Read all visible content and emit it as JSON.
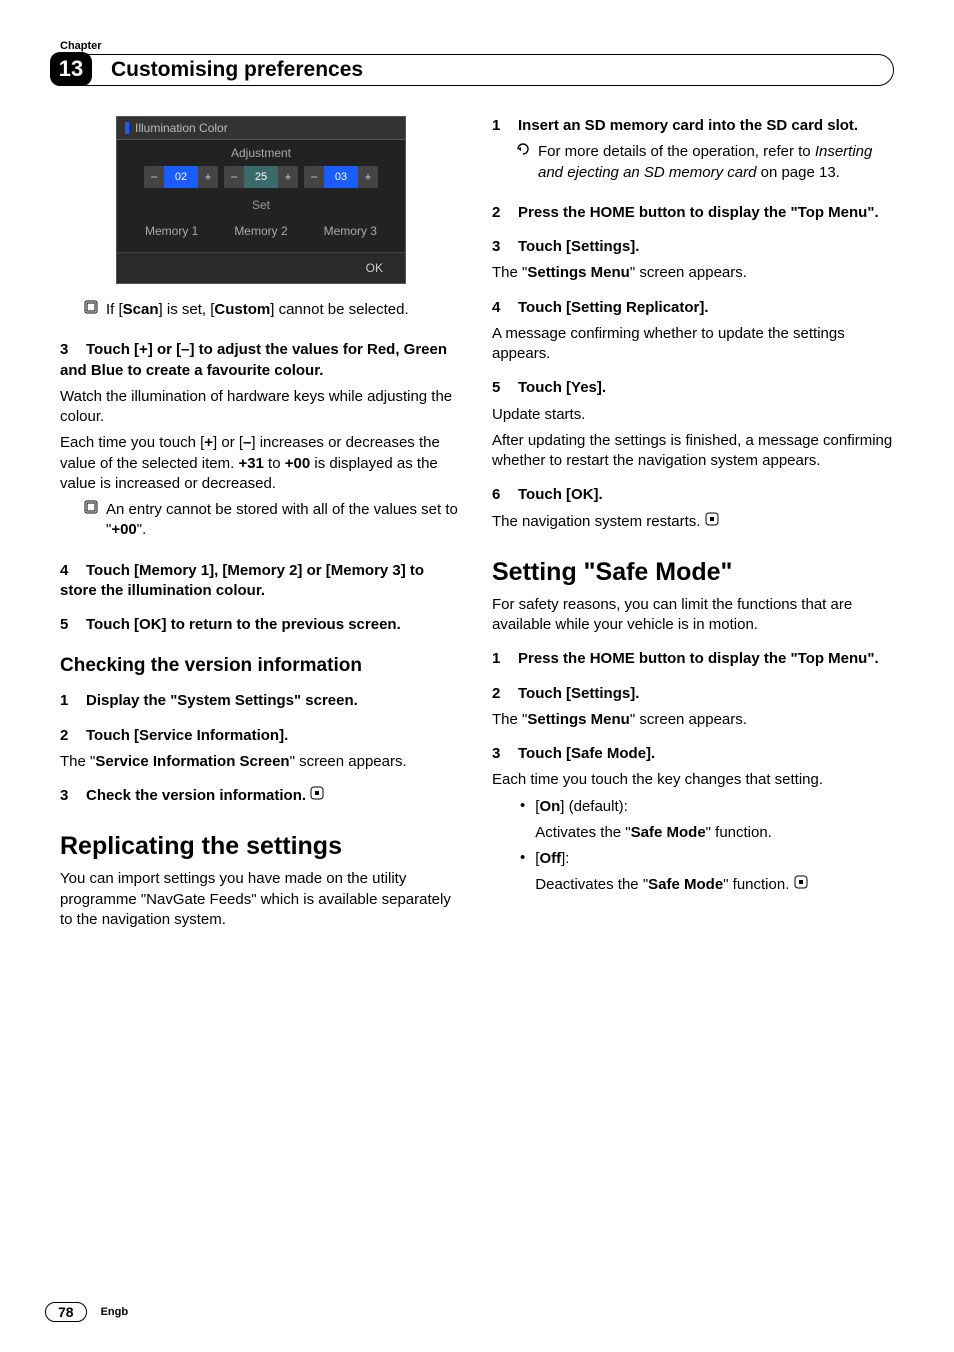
{
  "header": {
    "chapter_label": "Chapter",
    "chapter_number": "13",
    "title": "Customising preferences"
  },
  "screenshot": {
    "title": "Illumination Color",
    "adjustment": "Adjustment",
    "minus": "−",
    "plus": "+",
    "r_val": "02",
    "g_val": "25",
    "b_val": "03",
    "set": "Set",
    "mem1": "Memory 1",
    "mem2": "Memory 2",
    "mem3": "Memory 3",
    "ok": "OK"
  },
  "left": {
    "note_scan_a": "If [",
    "note_scan_b": "Scan",
    "note_scan_c": "] is set, [",
    "note_scan_d": "Custom",
    "note_scan_e": "] cannot be selected.",
    "s3_head_a": "3",
    "s3_head_b": "Touch [+] or [–] to adjust the values for Red, Green and Blue to create a favourite colour.",
    "s3_p1": "Watch the illumination of hardware keys while adjusting the colour.",
    "s3_p2a": "Each time you touch [",
    "s3_p2b": "+",
    "s3_p2c": "] or [",
    "s3_p2d": "–",
    "s3_p2e": "] increases or decreases the value of the selected item. ",
    "s3_p2f": "+31",
    "s3_p2g": " to ",
    "s3_p2h": "+00",
    "s3_p2i": " is displayed as the value is increased or decreased.",
    "s3_note_a": "An entry cannot be stored with all of the values set to \"",
    "s3_note_b": "+00",
    "s3_note_c": "\".",
    "s4_num": "4",
    "s4_head": "Touch [Memory 1], [Memory 2] or [Memory 3] to store the illumination colour.",
    "s5_num": "5",
    "s5_head": "Touch [OK] to return to the previous screen.",
    "sub1": "Checking the version information",
    "v1_num": "1",
    "v1_head": "Display the \"System Settings\" screen.",
    "v2_num": "2",
    "v2_head": "Touch [Service Information].",
    "v2_p_a": "The \"",
    "v2_p_b": "Service Information Screen",
    "v2_p_c": "\" screen appears.",
    "v3_num": "3",
    "v3_head": "Check the version information.",
    "sec1": "Replicating the settings",
    "rep_p": "You can import settings you have made on the utility programme \"NavGate Feeds\" which is available separately to the navigation system."
  },
  "right": {
    "r1_num": "1",
    "r1_head": "Insert an SD memory card into the SD card slot.",
    "r1_ref_a": "For more details of the operation, refer to ",
    "r1_ref_b": "Inserting and ejecting an SD memory card",
    "r1_ref_c": " on page 13.",
    "r2_num": "2",
    "r2_head": "Press the HOME button to display the \"Top Menu\".",
    "r3_num": "3",
    "r3_head": "Touch [Settings].",
    "r3_p_a": "The \"",
    "r3_p_b": "Settings Menu",
    "r3_p_c": "\" screen appears.",
    "r4_num": "4",
    "r4_head": "Touch [Setting Replicator].",
    "r4_p": "A message confirming whether to update the settings appears.",
    "r5_num": "5",
    "r5_head": "Touch [Yes].",
    "r5_p1": "Update starts.",
    "r5_p2": "After updating the settings is finished, a message confirming whether to restart the navigation system appears.",
    "r6_num": "6",
    "r6_head": "Touch [OK].",
    "r6_p": "The navigation system restarts.",
    "sec2": "Setting \"Safe Mode\"",
    "sm_p": "For safety reasons, you can limit the functions that are available while your vehicle is in motion.",
    "sm1_num": "1",
    "sm1_head": "Press the HOME button to display the \"Top Menu\".",
    "sm2_num": "2",
    "sm2_head": "Touch [Settings].",
    "sm2_p_a": "The \"",
    "sm2_p_b": "Settings Menu",
    "sm2_p_c": "\" screen appears.",
    "sm3_num": "3",
    "sm3_head": "Touch [Safe Mode].",
    "sm3_p": "Each time you touch the key changes that setting.",
    "sm_on_a": "[",
    "sm_on_b": "On",
    "sm_on_c": "] (default):",
    "sm_on_d": "Activates the \"",
    "sm_on_e": "Safe Mode",
    "sm_on_f": "\" function.",
    "sm_off_a": "[",
    "sm_off_b": "Off",
    "sm_off_c": "]:",
    "sm_off_d": "Deactivates the \"",
    "sm_off_e": "Safe Mode",
    "sm_off_f": "\" function."
  },
  "footer": {
    "page": "78",
    "locale": "Engb"
  }
}
